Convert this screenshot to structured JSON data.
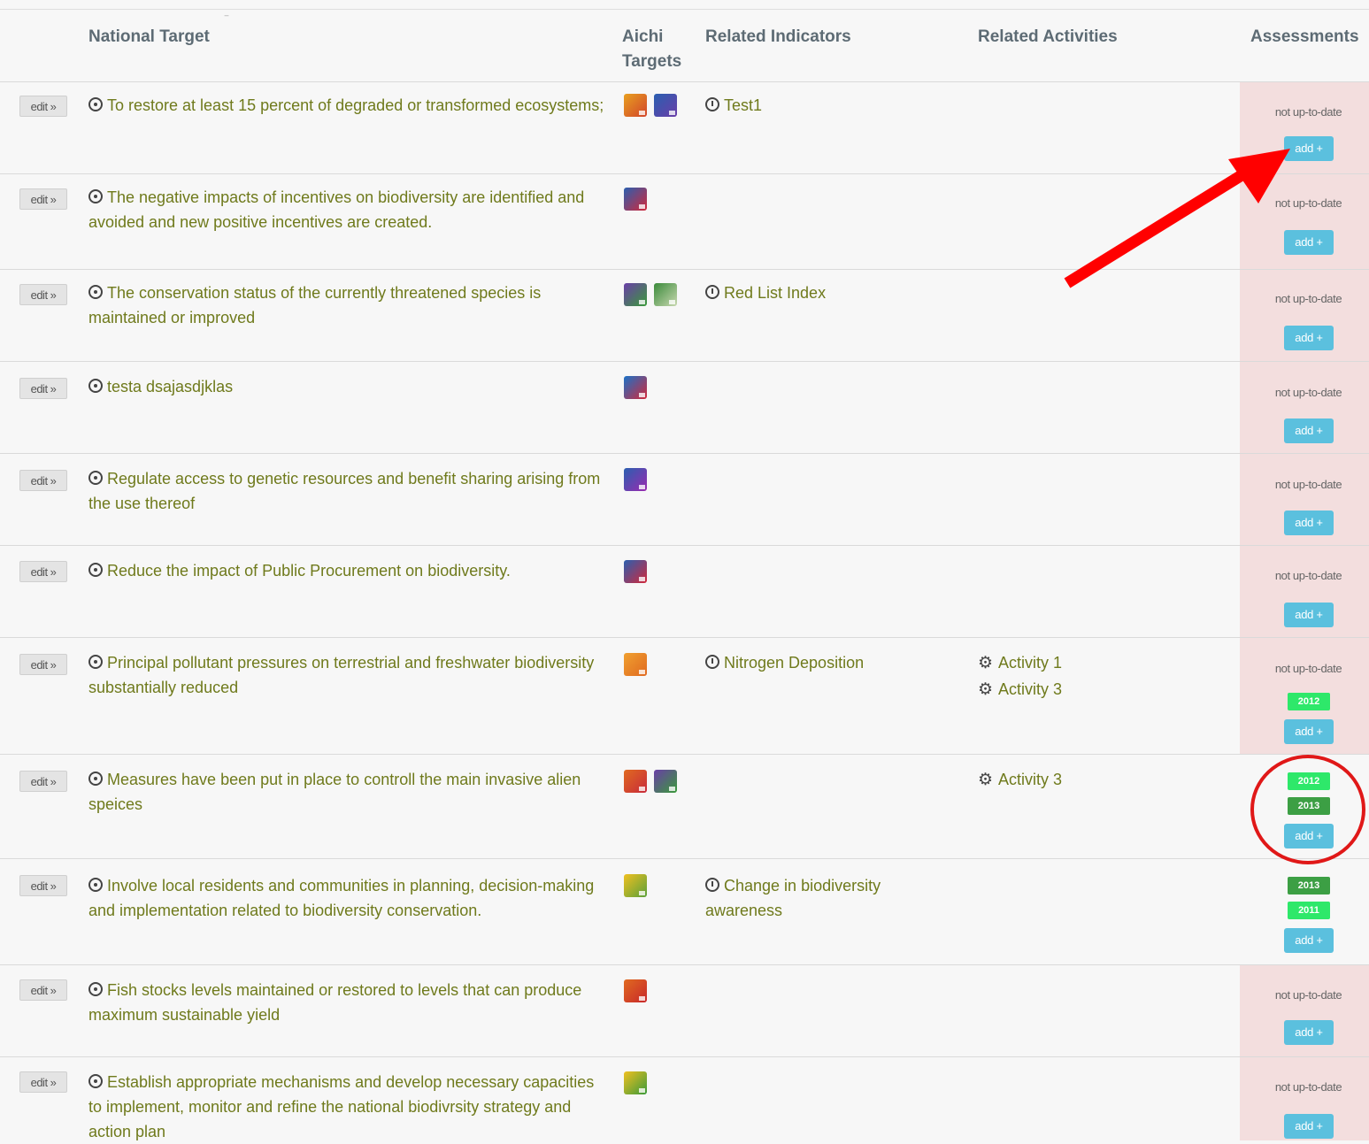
{
  "headers": {
    "national_target": "National Target",
    "aichi_line1": "Aichi",
    "aichi_line2": "Targets",
    "related_indicators": "Related Indicators",
    "related_activities": "Related Activities",
    "assessments": "Assessments"
  },
  "edit_label": "edit »",
  "add_label": "add +",
  "not_up_to_date": "not up-to-date",
  "colors": {
    "target_text": "#6f7a1c",
    "add_button": "#5bc0de",
    "pink_cell": "#f3dede",
    "year_bright": "#2ee86a",
    "year_dark": "#3c9f44",
    "annotation": "#ff0000"
  },
  "rows": [
    {
      "target": "To restore at least 15 percent of degraded or transformed ecosystems;",
      "aichi": [
        "aichi-target-14",
        "aichi-target-15"
      ],
      "indicator": "Test1",
      "activities": [],
      "status": "not up-to-date",
      "years": []
    },
    {
      "target": "The negative impacts of incentives on biodiversity are identified and avoided and new positive incentives are created.",
      "aichi": [
        "aichi-target-3"
      ],
      "indicator": "",
      "activities": [],
      "status": "not up-to-date",
      "years": []
    },
    {
      "target": "The conservation status of the currently threatened species is maintained or improved",
      "aichi": [
        "aichi-target-12",
        "aichi-target-13"
      ],
      "indicator": "Red List Index",
      "activities": [],
      "status": "not up-to-date",
      "years": []
    },
    {
      "target": "testa dsajasdjklas",
      "aichi": [
        "aichi-target-1"
      ],
      "indicator": "",
      "activities": [],
      "status": "not up-to-date",
      "years": []
    },
    {
      "target": "Regulate access to genetic resources and benefit sharing arising from the use thereof",
      "aichi": [
        "aichi-target-16"
      ],
      "indicator": "",
      "activities": [],
      "status": "not up-to-date",
      "years": []
    },
    {
      "target": "Reduce the impact of Public Procurement on biodiversity.",
      "aichi": [
        "aichi-target-2"
      ],
      "indicator": "",
      "activities": [],
      "status": "not up-to-date",
      "years": []
    },
    {
      "target": "Principal pollutant pressures on terrestrial and freshwater biodiversity substantially reduced",
      "aichi": [
        "aichi-target-8"
      ],
      "indicator": "Nitrogen Deposition",
      "activities": [
        "Activity 1",
        "Activity 3"
      ],
      "status": "not up-to-date",
      "years": [
        "2012"
      ]
    },
    {
      "target": "Measures have been put in place to controll the main invasive alien speices",
      "aichi": [
        "aichi-target-9",
        "aichi-target-12"
      ],
      "indicator": "",
      "activities": [
        "Activity 3"
      ],
      "status": "",
      "years": [
        "2012",
        "2013"
      ]
    },
    {
      "target": "Involve local residents and communities in planning, decision-making and implementation related to biodiversity conservation.",
      "aichi": [
        "aichi-target-18"
      ],
      "indicator": "Change in biodiversity awareness",
      "activities": [],
      "status": "",
      "years": [
        "2013",
        "2011"
      ]
    },
    {
      "target": "Fish stocks levels maintained or restored to levels that can produce maximum sustainable yield",
      "aichi": [
        "aichi-target-6"
      ],
      "indicator": "",
      "activities": [],
      "status": "not up-to-date",
      "years": []
    },
    {
      "target": "Establish appropriate mechanisms and develop necessary capacities to implement, monitor and refine the national biodivrsity strategy and action plan",
      "aichi": [
        "aichi-target-17"
      ],
      "indicator": "",
      "activities": [],
      "status": "not up-to-date",
      "years": []
    }
  ]
}
